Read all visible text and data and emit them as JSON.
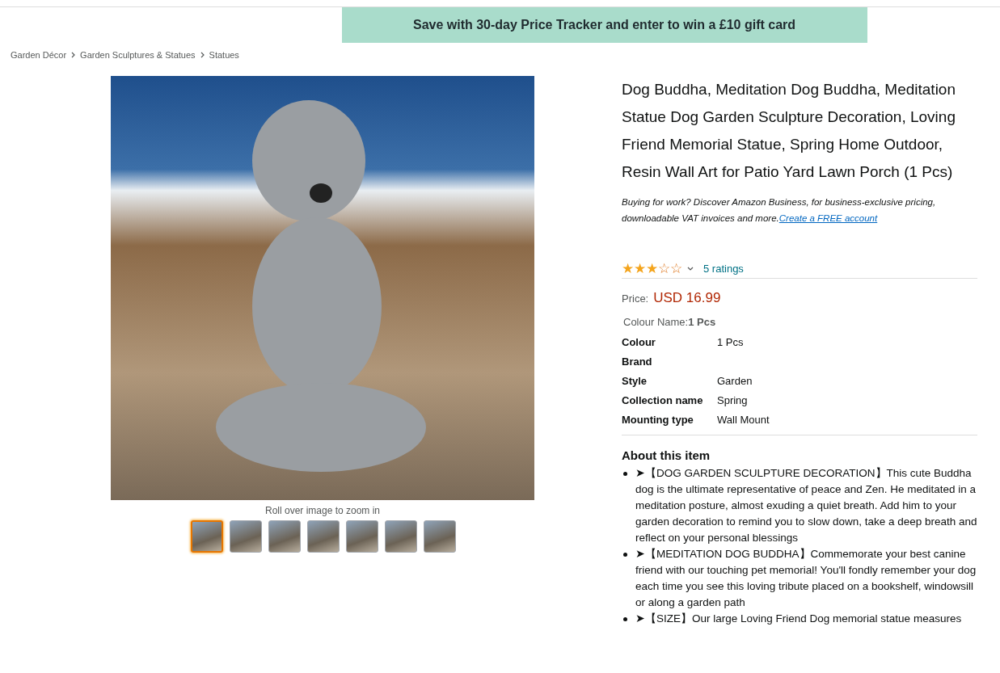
{
  "banner": {
    "text": "Save with 30-day Price Tracker and enter to win a £10 gift card"
  },
  "breadcrumb": [
    "Garden Décor",
    "Garden Sculptures & Statues",
    "Statues"
  ],
  "gallery": {
    "hint": "Roll over image to zoom in",
    "thumbnails": [
      {
        "selected": true
      },
      {
        "selected": false
      },
      {
        "selected": false
      },
      {
        "selected": false
      },
      {
        "selected": false
      },
      {
        "selected": false
      },
      {
        "selected": false
      }
    ]
  },
  "product": {
    "title": "Dog Buddha, Meditation Dog Buddha, Meditation Statue Dog Garden Sculpture Decoration, Loving Friend Memorial Statue, Spring Home Outdoor, Resin Wall Art for Patio Yard Lawn Porch (1 Pcs)",
    "business_note": "Buying for work? Discover Amazon Business, for business-exclusive pricing, downloadable VAT invoices and more.",
    "business_link": "Create a FREE account",
    "stars": 3,
    "ratings": "5 ratings",
    "price_label": "Price:",
    "price": "USD 16.99",
    "colour_name_label": "Colour Name:",
    "colour_name_value": "1 Pcs",
    "specs": [
      {
        "label": "Colour",
        "value": "1 Pcs"
      },
      {
        "label": "Brand"
      },
      {
        "label": "Style",
        "value": "Garden"
      },
      {
        "label": "Collection name",
        "value": "Spring"
      },
      {
        "label": "Mounting type",
        "value": "Wall Mount"
      }
    ],
    "about_heading": "About this item",
    "bullets": [
      "➤【DOG GARDEN SCULPTURE DECORATION】This cute Buddha dog is the ultimate representative of peace and Zen. He meditated in a meditation posture, almost exuding a quiet breath. Add him to your garden decoration to remind you to slow down, take a deep breath and reflect on your personal blessings",
      "➤【MEDITATION DOG BUDDHA】Commemorate your best canine friend with our touching pet memorial! You'll fondly remember your dog each time you see this loving tribute placed on a bookshelf, windowsill or along a garden path",
      "➤【SIZE】Our large Loving Friend Dog memorial statue measures"
    ]
  }
}
